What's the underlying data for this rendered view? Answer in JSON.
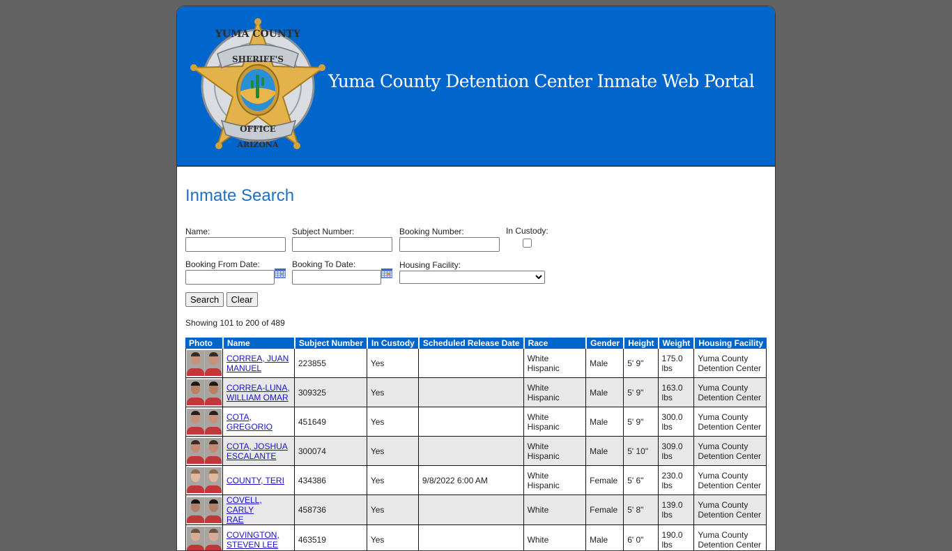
{
  "header": {
    "title": "Yuma County Detention Center Inmate Web Portal",
    "badge": {
      "top_text": "YUMA COUNTY",
      "upper_ribbon": "SHERIFF'S",
      "lower_ribbon": "OFFICE",
      "bottom_text": "ARIZONA"
    }
  },
  "search": {
    "heading": "Inmate Search",
    "fields": {
      "name": {
        "label": "Name:",
        "value": ""
      },
      "subject_number": {
        "label": "Subject Number:",
        "value": ""
      },
      "booking_number": {
        "label": "Booking Number:",
        "value": ""
      },
      "in_custody": {
        "label": "In Custody:",
        "checked": false
      },
      "booking_from": {
        "label": "Booking From Date:",
        "value": ""
      },
      "booking_to": {
        "label": "Booking To Date:",
        "value": ""
      },
      "housing_facility": {
        "label": "Housing Facility:",
        "selected": ""
      }
    },
    "buttons": {
      "search": "Search",
      "clear": "Clear"
    },
    "showing": "Showing 101 to 200 of 489"
  },
  "table": {
    "columns": [
      "Photo",
      "Name",
      "Subject Number",
      "In Custody",
      "Scheduled Release Date",
      "Race",
      "Gender",
      "Height",
      "Weight",
      "Housing Facility"
    ],
    "rows": [
      {
        "name_line1": "CORREA, JUAN",
        "name_line2": "MANUEL",
        "subject": "223855",
        "custody": "Yes",
        "release": "",
        "race": "White Hispanic",
        "gender": "Male",
        "height": "5' 9\"",
        "weight": "175.0 lbs",
        "facility_line1": "Yuma County",
        "facility_line2": "Detention Center"
      },
      {
        "name_line1": "CORREA-LUNA,",
        "name_line2": "WILLIAM OMAR",
        "subject": "309325",
        "custody": "Yes",
        "release": "",
        "race": "White Hispanic",
        "gender": "Male",
        "height": "5' 9\"",
        "weight": "163.0 lbs",
        "facility_line1": "Yuma County",
        "facility_line2": "Detention Center"
      },
      {
        "name_line1": "COTA,",
        "name_line2": "GREGORIO",
        "subject": "451649",
        "custody": "Yes",
        "release": "",
        "race": "White Hispanic",
        "gender": "Male",
        "height": "5' 9\"",
        "weight": "300.0 lbs",
        "facility_line1": "Yuma County",
        "facility_line2": "Detention Center"
      },
      {
        "name_line1": "COTA, JOSHUA",
        "name_line2": "ESCALANTE",
        "subject": "300074",
        "custody": "Yes",
        "release": "",
        "race": "White Hispanic",
        "gender": "Male",
        "height": "5' 10\"",
        "weight": "309.0 lbs",
        "facility_line1": "Yuma County",
        "facility_line2": "Detention Center"
      },
      {
        "name_line1": "COUNTY, TERI",
        "name_line2": "",
        "subject": "434386",
        "custody": "Yes",
        "release": "9/8/2022 6:00 AM",
        "race": "White Hispanic",
        "gender": "Female",
        "height": "5' 6\"",
        "weight": "230.0 lbs",
        "facility_line1": "Yuma County",
        "facility_line2": "Detention Center"
      },
      {
        "name_line1": "COVELL, CARLY",
        "name_line2": "RAE",
        "subject": "458736",
        "custody": "Yes",
        "release": "",
        "race": "White",
        "gender": "Female",
        "height": "5' 8\"",
        "weight": "139.0 lbs",
        "facility_line1": "Yuma County",
        "facility_line2": "Detention Center"
      },
      {
        "name_line1": "COVINGTON,",
        "name_line2": "STEVEN LEE",
        "subject": "463519",
        "custody": "Yes",
        "release": "",
        "race": "White",
        "gender": "Male",
        "height": "6' 0\"",
        "weight": "190.0 lbs",
        "facility_line1": "Yuma County",
        "facility_line2": "Detention Center"
      }
    ]
  },
  "colors": {
    "brand_blue": "#0066cc",
    "heading_blue": "#1f6fc5",
    "page_background": "#626262",
    "alt_row": "#e8e8e8"
  }
}
